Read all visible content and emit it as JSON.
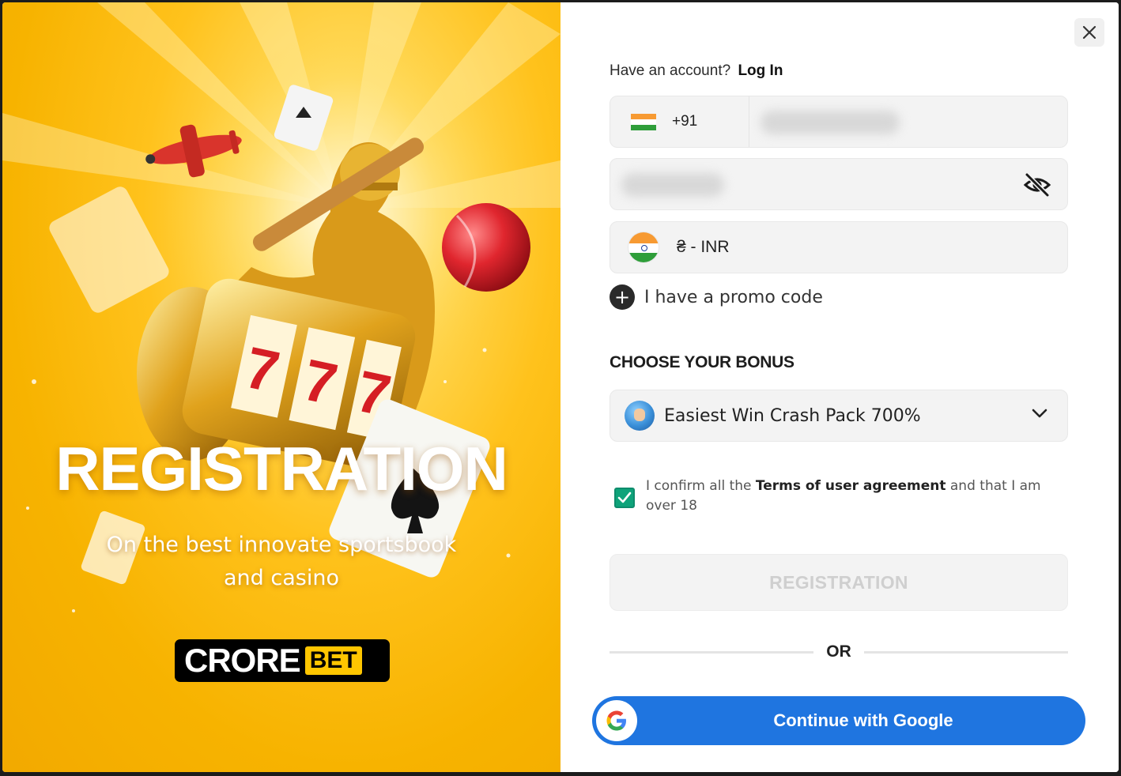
{
  "promo": {
    "title": "REGISTRATION",
    "subtitle": "On the best innovate sportsbook and casino",
    "logo_main": "CRORE",
    "logo_tag": "BET"
  },
  "form": {
    "have_account": "Have an account?",
    "login_link": "Log In",
    "phone_code": "+91",
    "currency": "₴ - INR",
    "promo_code_label": "I have a promo code",
    "bonus_heading": "CHOOSE YOUR BONUS",
    "bonus_selected": "Easiest Win Crash Pack 700%",
    "confirm_prefix": "I confirm all the",
    "confirm_terms": "Terms of user agreement",
    "confirm_suffix": "and that I am over 18",
    "confirm_checked": true,
    "register_button": "REGISTRATION",
    "or_label": "OR",
    "google_button": "Continue with Google"
  },
  "icons": {
    "close": "close-icon",
    "eye": "eye-off-icon",
    "plus": "plus-icon",
    "chevron": "chevron-down-icon",
    "google": "google-icon",
    "check": "check-icon"
  },
  "colors": {
    "promo_bg": "#f7b300",
    "google_blue": "#1f75e0",
    "check_green": "#0ea37a",
    "disabled_text": "#cfcfcf"
  }
}
